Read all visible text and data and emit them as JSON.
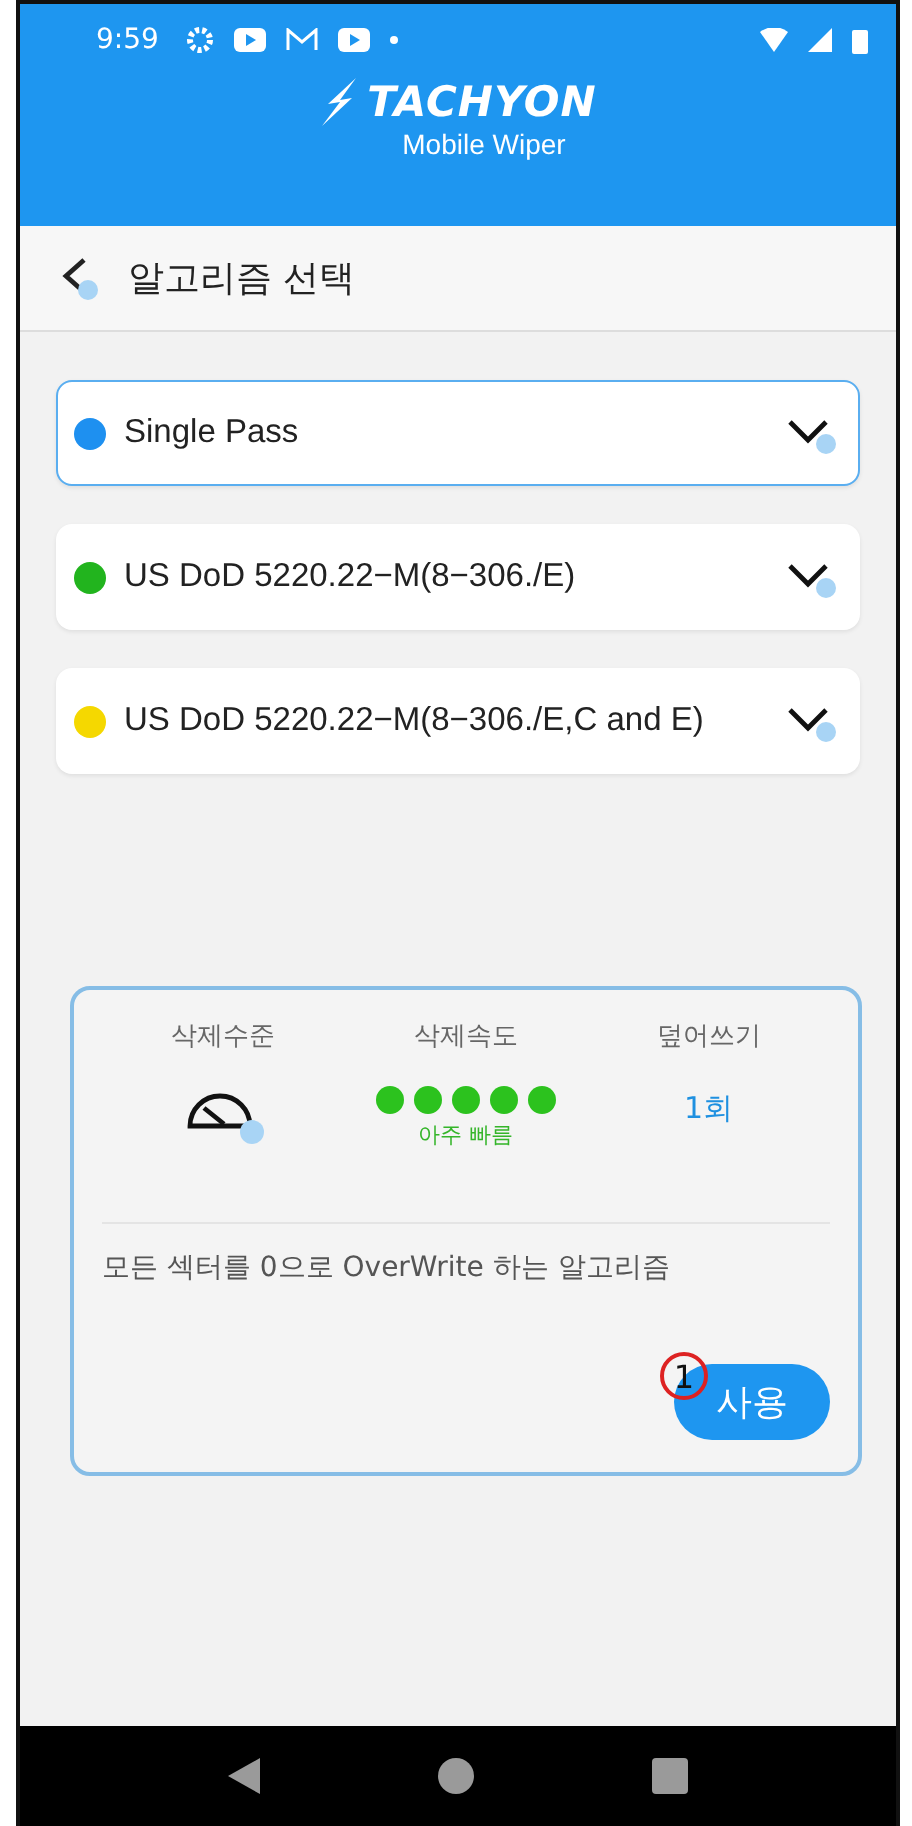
{
  "status_bar": {
    "time": "9:59"
  },
  "header": {
    "brand": "TACHYON",
    "subtitle": "Mobile Wiper"
  },
  "title_bar": {
    "title": "알고리즘 선택"
  },
  "algorithms": [
    {
      "label": "Single Pass",
      "color": "#1e90f0",
      "selected": true
    },
    {
      "label": "US DoD 5220.22−M(8−306./E)",
      "color": "#22b41e",
      "selected": false
    },
    {
      "label": "US DoD 5220.22−M(8−306./E,C and E)",
      "color": "#f5d800",
      "selected": false
    }
  ],
  "detail": {
    "columns": [
      {
        "kind": "level",
        "heading": "삭제수준"
      },
      {
        "kind": "speed",
        "heading": "삭제속도",
        "stars": 5,
        "caption": "아주 빠름"
      },
      {
        "kind": "count",
        "heading": "덮어쓰기",
        "value": "1회"
      }
    ],
    "description": "모든 섹터를 0으로 OverWrite 하는 알고리즘",
    "button": "사용",
    "marker": "1"
  }
}
